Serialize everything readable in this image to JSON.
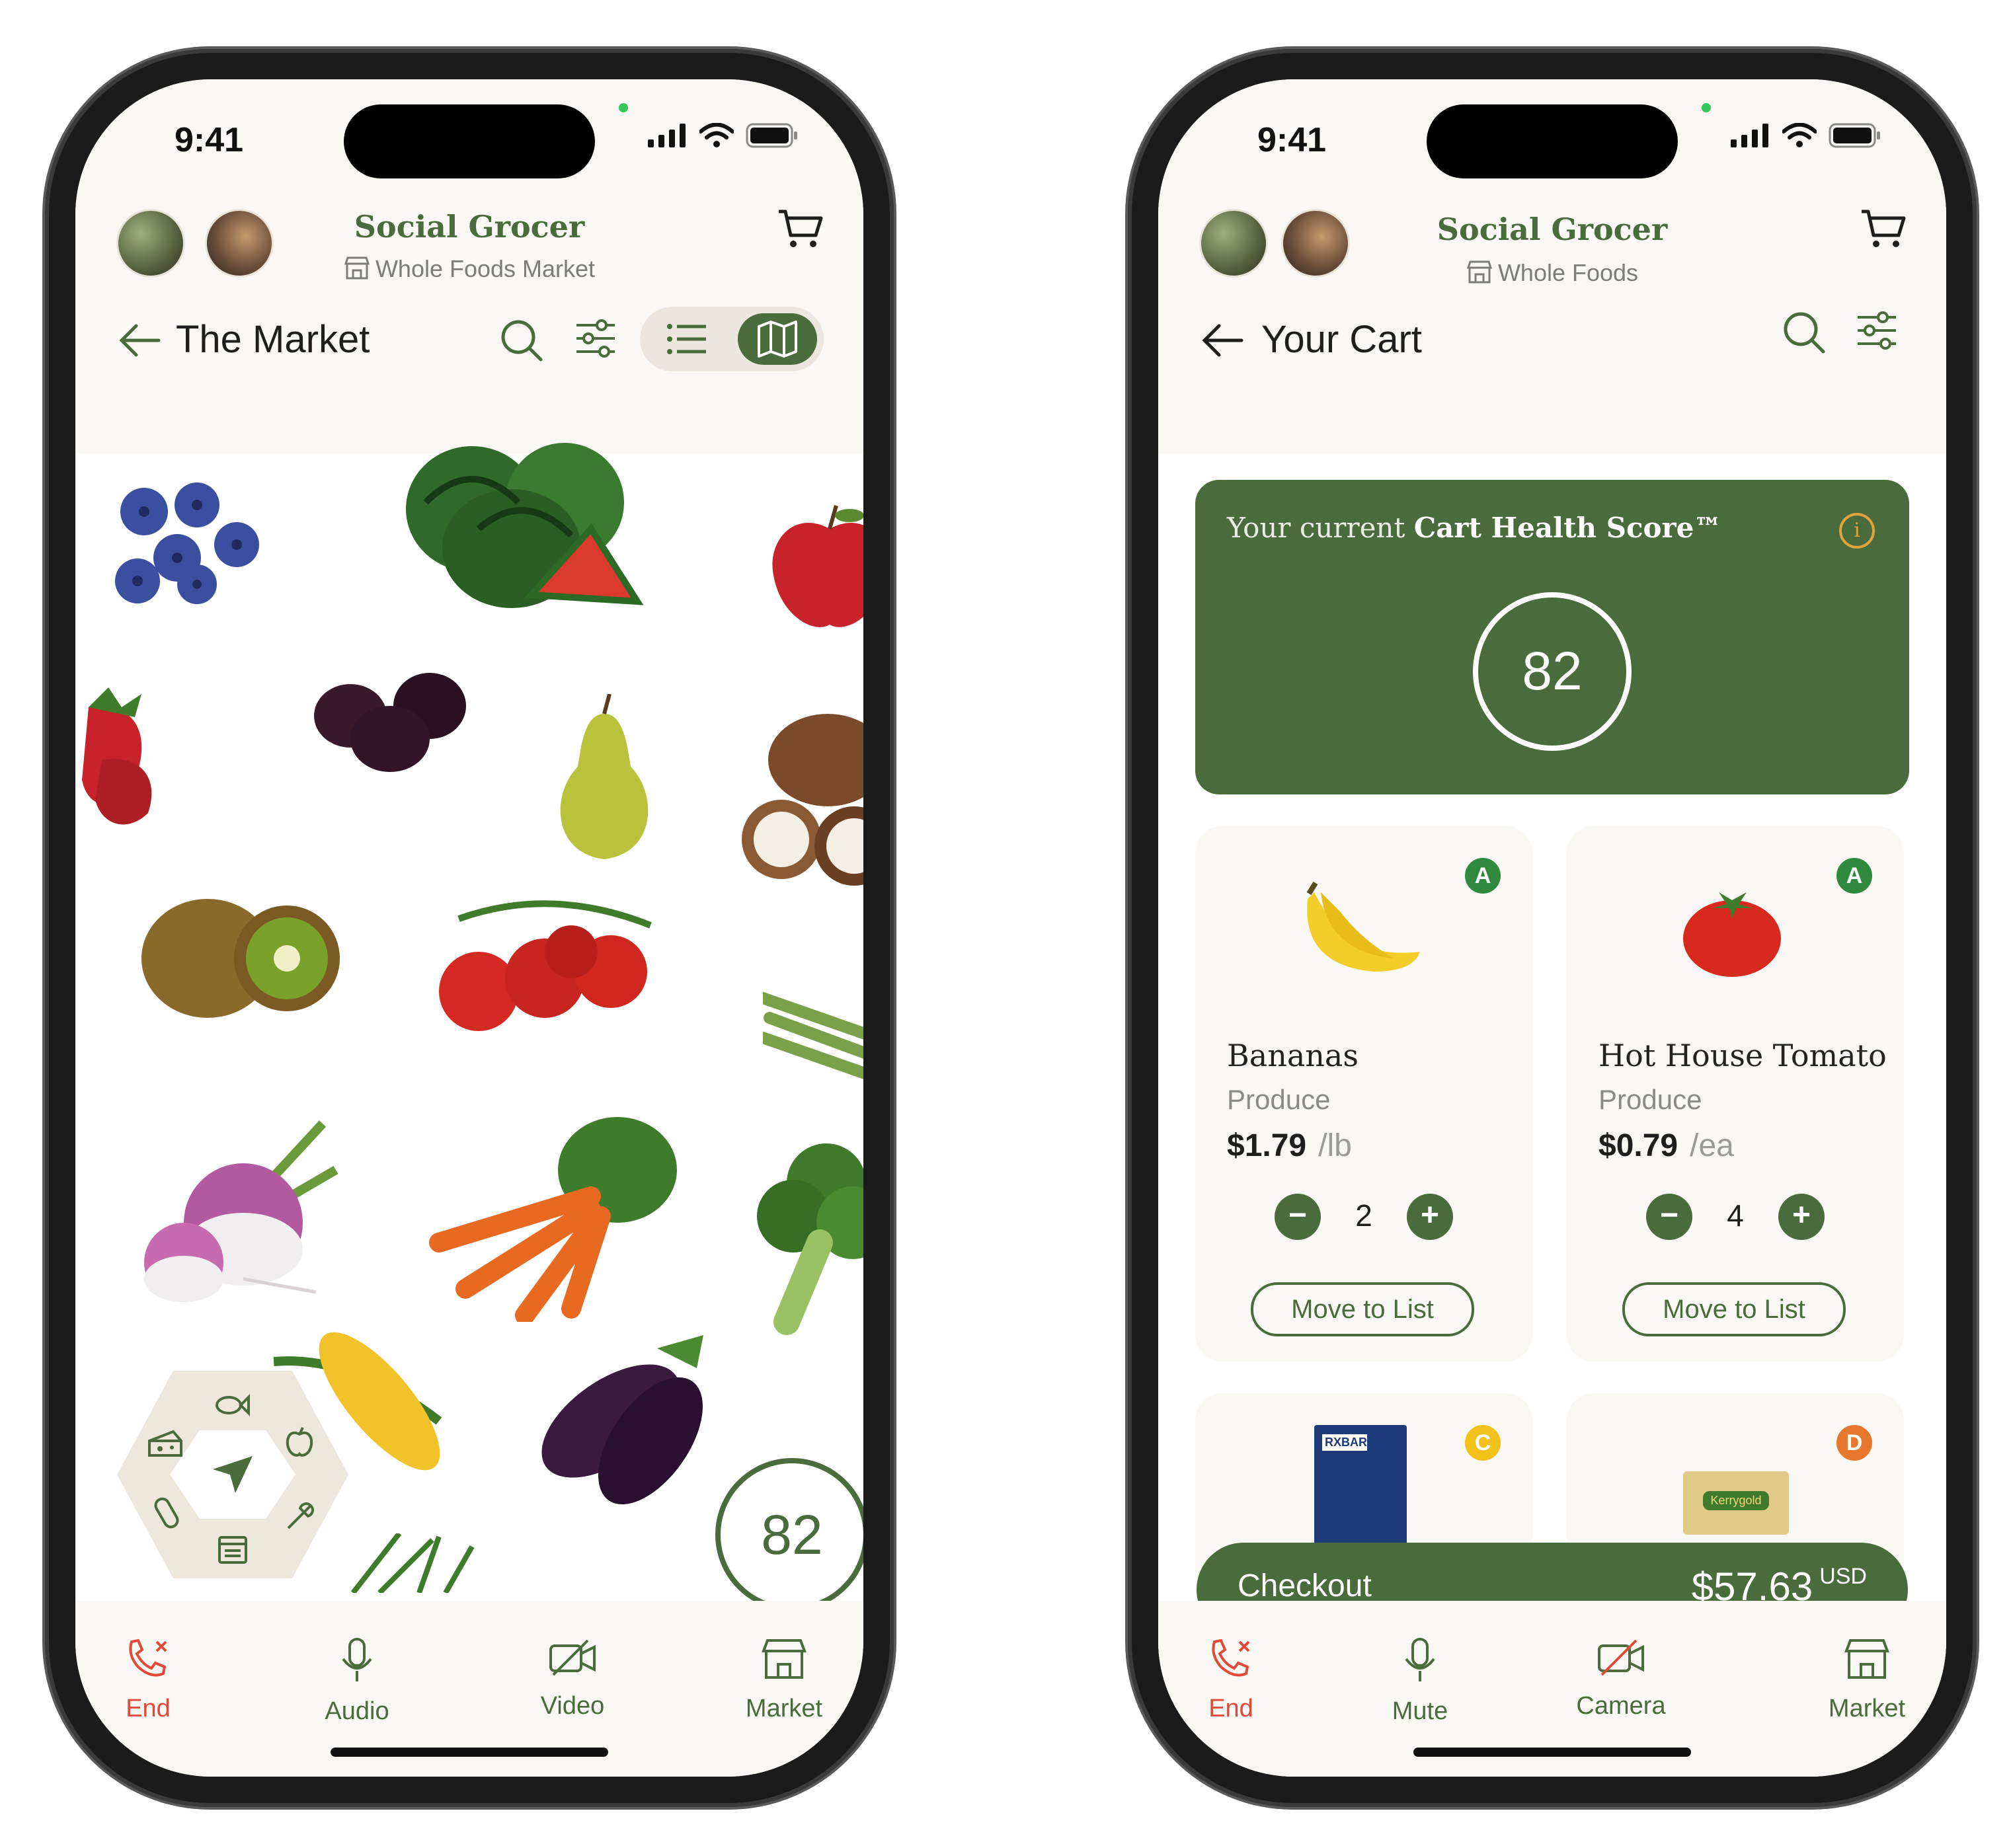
{
  "left_phone": {
    "status": {
      "time": "9:41"
    },
    "header": {
      "brand": "Social Grocer",
      "store": "Whole Foods Market"
    },
    "title": "The Market",
    "score": "82",
    "tabs": [
      "End",
      "Audio",
      "Video",
      "Market"
    ]
  },
  "right_phone": {
    "status": {
      "time": "9:41"
    },
    "header": {
      "brand": "Social Grocer",
      "store": "Whole Foods"
    },
    "title": "Your Cart",
    "health": {
      "prefix": "Your current ",
      "label": "Cart Health Score™",
      "info": "i",
      "score": "82"
    },
    "items": [
      {
        "name": "Bananas",
        "category": "Produce",
        "price": "$1.79",
        "unit": "/lb",
        "qty": "2",
        "grade": "A",
        "action": "Move to List"
      },
      {
        "name": "Hot House Tomato",
        "category": "Produce",
        "price": "$0.79",
        "unit": "/ea",
        "qty": "4",
        "grade": "A",
        "action": "Move to List"
      },
      {
        "grade": "C",
        "package_text": "RXBAR"
      },
      {
        "grade": "D",
        "package_text": "Kerrygold"
      }
    ],
    "checkout": {
      "label": "Checkout",
      "total": "$57.63",
      "currency": "USD"
    },
    "tabs": [
      "End",
      "Mute",
      "Camera",
      "Market"
    ]
  },
  "colors": {
    "accent": "#4a6b3c",
    "end": "#e04a3a",
    "grade_a": "#2f8a3d",
    "grade_c": "#f2c21b",
    "grade_d": "#e8772e"
  }
}
